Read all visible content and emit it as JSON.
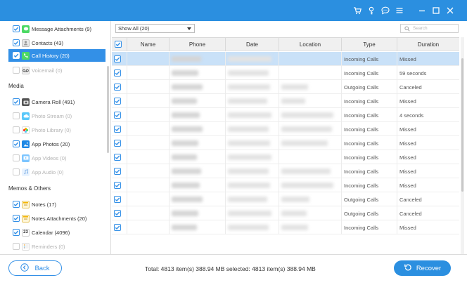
{
  "window": {
    "controls": [
      "cart-icon",
      "key-icon",
      "chat-icon",
      "menu-icon",
      "minimize-icon",
      "maximize-icon",
      "close-icon"
    ],
    "accent": "#2b8fe0"
  },
  "sidebar": {
    "items_top": [
      {
        "label": "Message Attachments (9)",
        "checked": true,
        "icon": "message-icon",
        "enabled": true
      },
      {
        "label": "Contacts (43)",
        "checked": true,
        "icon": "contacts-icon",
        "enabled": true
      },
      {
        "label": "Call History (20)",
        "checked": true,
        "icon": "phone-icon",
        "enabled": true,
        "selected": true
      },
      {
        "label": "Voicemail (0)",
        "checked": false,
        "icon": "voicemail-icon",
        "enabled": false
      }
    ],
    "media_title": "Media",
    "media_items": [
      {
        "label": "Camera Roll (491)",
        "checked": true,
        "icon": "camera-icon",
        "enabled": true
      },
      {
        "label": "Photo Stream (0)",
        "checked": false,
        "icon": "photo-stream-icon",
        "enabled": false
      },
      {
        "label": "Photo Library (0)",
        "checked": false,
        "icon": "photo-library-icon",
        "enabled": false
      },
      {
        "label": "App Photos (20)",
        "checked": true,
        "icon": "app-photos-icon",
        "enabled": true
      },
      {
        "label": "App Videos (0)",
        "checked": false,
        "icon": "app-videos-icon",
        "enabled": false
      },
      {
        "label": "App Audio (0)",
        "checked": false,
        "icon": "app-audio-icon",
        "enabled": false
      }
    ],
    "memos_title": "Memos & Others",
    "memo_items": [
      {
        "label": "Notes (17)",
        "checked": true,
        "icon": "notes-icon",
        "enabled": true
      },
      {
        "label": "Notes Attachments (20)",
        "checked": true,
        "icon": "notes-attachments-icon",
        "enabled": true
      },
      {
        "label": "Calendar (4096)",
        "checked": true,
        "icon": "calendar-icon",
        "enabled": true,
        "icon_text": "23"
      },
      {
        "label": "Reminders (0)",
        "checked": false,
        "icon": "reminders-icon",
        "enabled": false
      }
    ]
  },
  "toolbar": {
    "filter_value": "Show All (20)",
    "search_placeholder": "Search"
  },
  "table": {
    "columns": [
      "Name",
      "Phone",
      "Date",
      "Location",
      "Type",
      "Duration"
    ],
    "rows": [
      {
        "type": "Incoming Calls",
        "duration": "Missed",
        "has_location": false,
        "selected": true
      },
      {
        "type": "Incoming Calls",
        "duration": "59 seconds",
        "has_location": false
      },
      {
        "type": "Outgoing Calls",
        "duration": "Canceled",
        "has_location": true
      },
      {
        "type": "Incoming Calls",
        "duration": "Missed",
        "has_location": true
      },
      {
        "type": "Incoming Calls",
        "duration": "4 seconds",
        "has_location": true
      },
      {
        "type": "Incoming Calls",
        "duration": "Missed",
        "has_location": true
      },
      {
        "type": "Incoming Calls",
        "duration": "Missed",
        "has_location": true
      },
      {
        "type": "Incoming Calls",
        "duration": "Missed",
        "has_location": false
      },
      {
        "type": "Incoming Calls",
        "duration": "Missed",
        "has_location": true
      },
      {
        "type": "Incoming Calls",
        "duration": "Missed",
        "has_location": true
      },
      {
        "type": "Outgoing Calls",
        "duration": "Canceled",
        "has_location": true
      },
      {
        "type": "Outgoing Calls",
        "duration": "Canceled",
        "has_location": true
      },
      {
        "type": "Incoming Calls",
        "duration": "Missed",
        "has_location": true
      }
    ]
  },
  "footer": {
    "back_label": "Back",
    "totals_text": "Total: 4813 item(s) 388.94 MB    selected: 4813 item(s) 388.94 MB",
    "recover_label": "Recover"
  }
}
